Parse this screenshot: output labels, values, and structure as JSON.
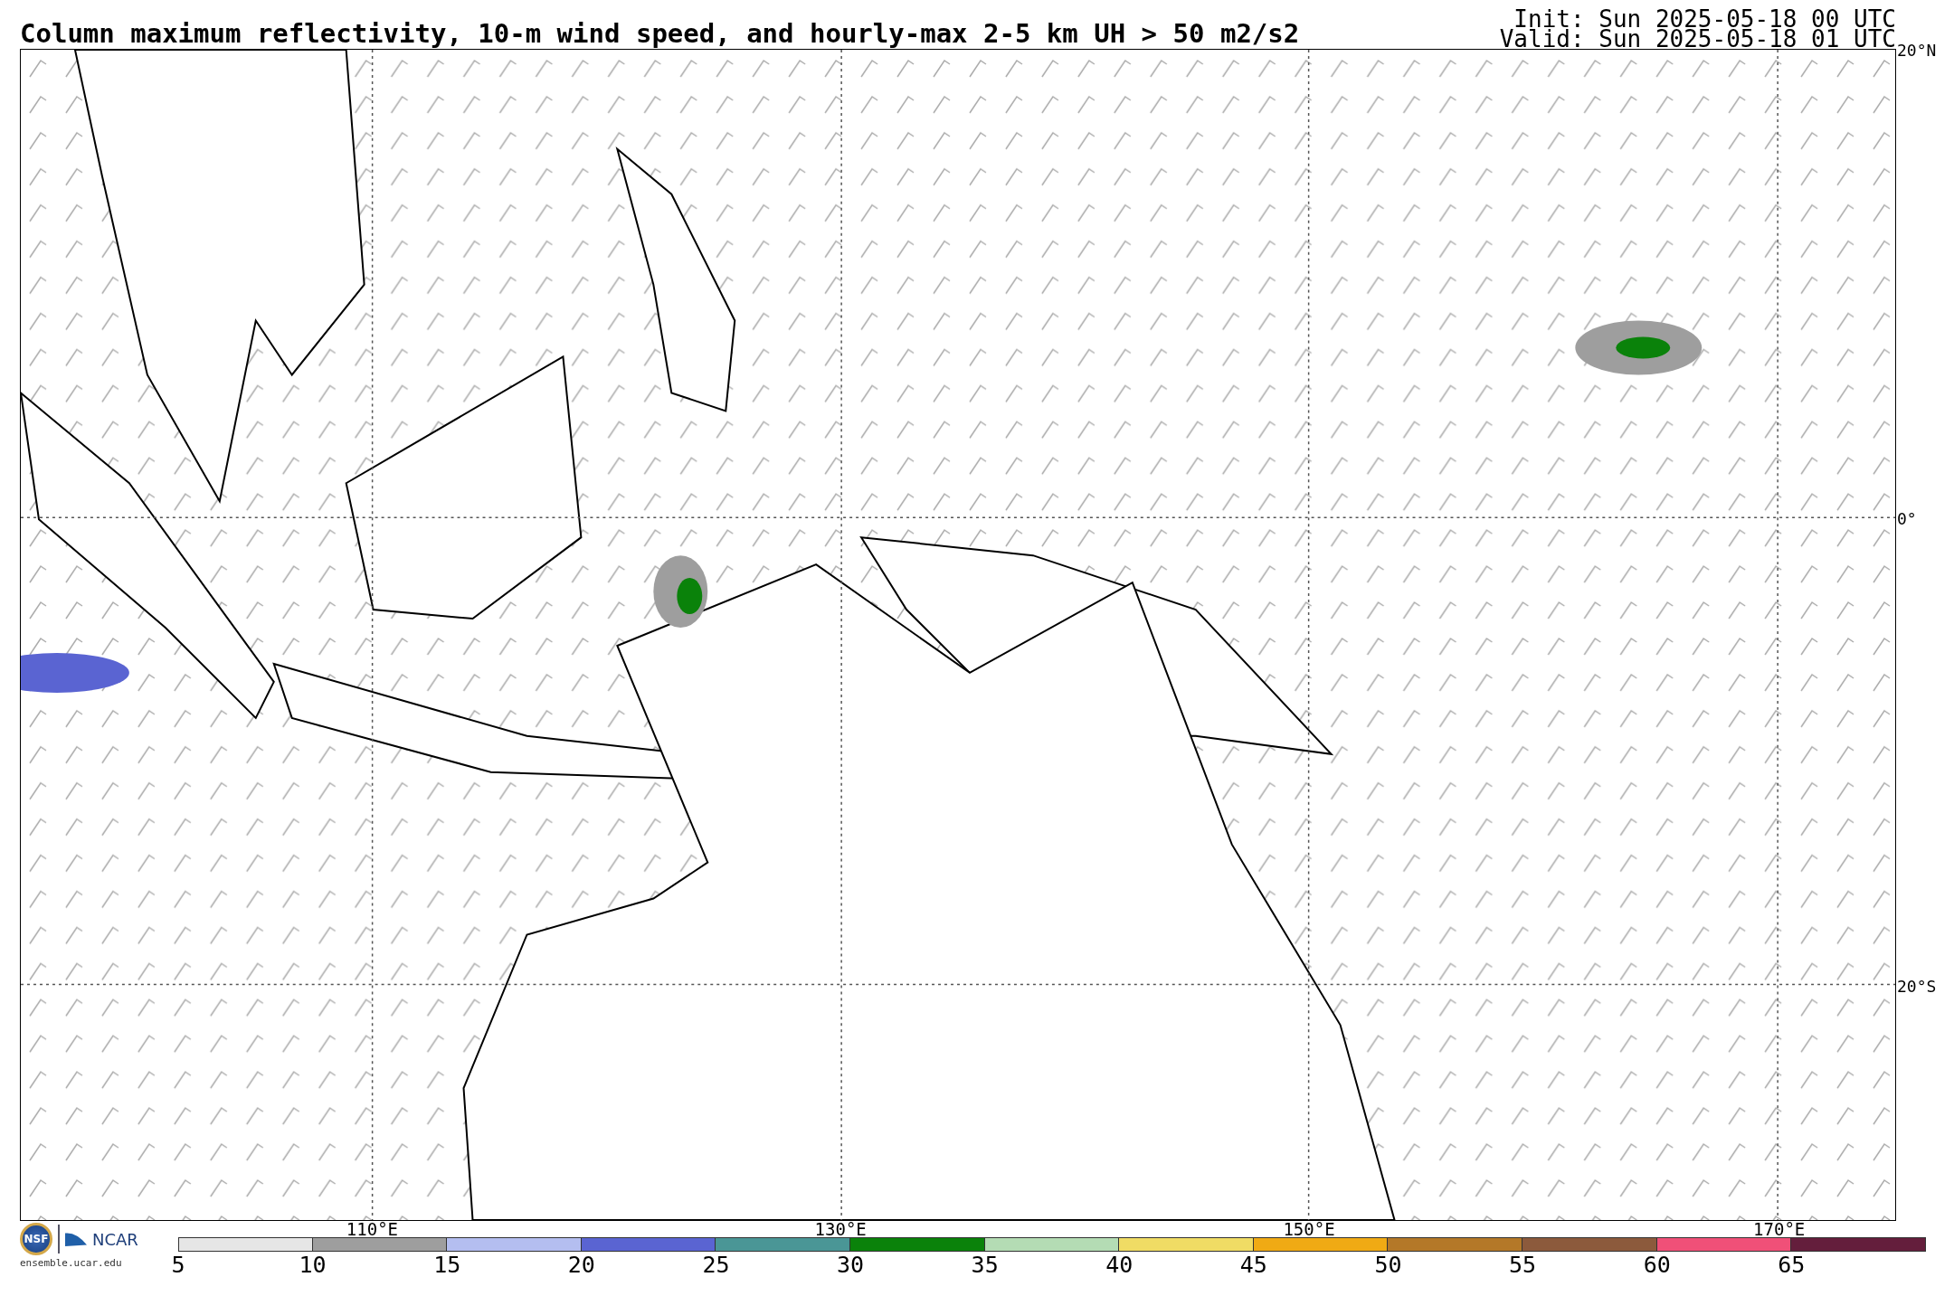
{
  "title": "Column maximum reflectivity, 10-m wind speed, and hourly-max 2-5 km UH > 50 m2/s2",
  "init": "Init: Sun 2025-05-18 00 UTC",
  "valid": "Valid: Sun 2025-05-18 01 UTC",
  "map": {
    "lat_labels": [
      "20°N",
      "0°",
      "20°S"
    ],
    "lon_labels": [
      "110°E",
      "130°E",
      "150°E",
      "170°E"
    ]
  },
  "logos": {
    "nsf": "NSF",
    "ncar": "NCAR",
    "url": "ensemble.ucar.edu"
  },
  "colorbar": {
    "segments": [
      {
        "label": "5",
        "color": "#e6e6e6"
      },
      {
        "label": "10",
        "color": "#9e9e9e"
      },
      {
        "label": "15",
        "color": "#b4bef0"
      },
      {
        "label": "20",
        "color": "#5a64d2"
      },
      {
        "label": "25",
        "color": "#4a9696"
      },
      {
        "label": "30",
        "color": "#0a820a"
      },
      {
        "label": "35",
        "color": "#b4dcb4"
      },
      {
        "label": "40",
        "color": "#f0dc64"
      },
      {
        "label": "45",
        "color": "#f0aa14"
      },
      {
        "label": "50",
        "color": "#b47828"
      },
      {
        "label": "55",
        "color": "#8c5a3c"
      },
      {
        "label": "60",
        "color": "#f05078"
      },
      {
        "label": "65",
        "color": "#641e3c"
      }
    ]
  }
}
